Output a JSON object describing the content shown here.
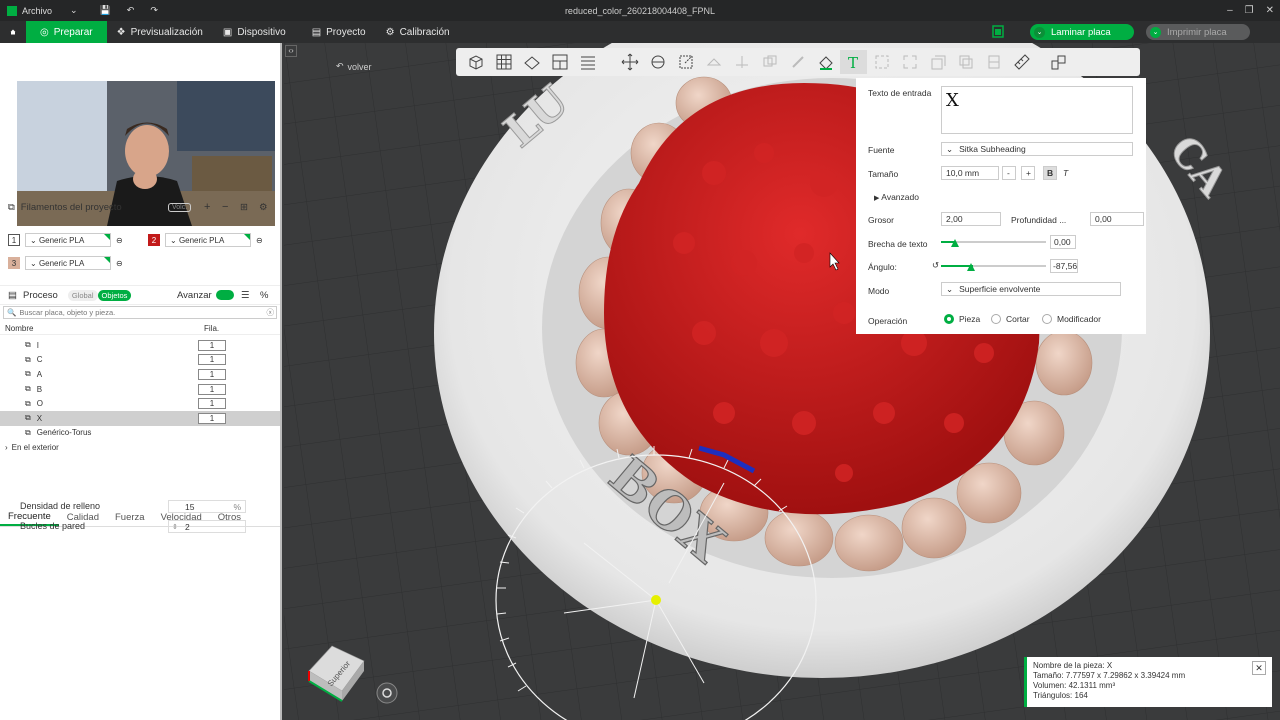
{
  "titlebar": {
    "app_menu": "Archivo",
    "file_title": "reduced_color_260218004408_FPNL"
  },
  "menubar": {
    "tabs": [
      "Preparar",
      "Previsualización",
      "Dispositivo",
      "Proyecto",
      "Calibración"
    ],
    "slice_button": "Laminar placa",
    "print_button": "Imprimir placa"
  },
  "filaments": {
    "title": "Filamentos del proyecto",
    "vol_label": "Volc.",
    "items": [
      {
        "num": "1",
        "name": "Generic PLA",
        "color": "#ffffff"
      },
      {
        "num": "2",
        "name": "Generic PLA",
        "color": "#c21a1a"
      },
      {
        "num": "3",
        "name": "Generic PLA",
        "color": "#d9b09b"
      }
    ]
  },
  "process": {
    "title": "Proceso",
    "global_label": "Global",
    "objects_label": "Objetos",
    "advanced_label": "Avanzar",
    "search_placeholder": "Buscar placa, objeto y pieza.",
    "col_name": "Nombre",
    "col_count": "Fila.",
    "rows": [
      {
        "name": "I",
        "count": "1"
      },
      {
        "name": "C",
        "count": "1"
      },
      {
        "name": "A",
        "count": "1"
      },
      {
        "name": "B",
        "count": "1"
      },
      {
        "name": "O",
        "count": "1"
      },
      {
        "name": "X",
        "count": "1"
      },
      {
        "name": "Genérico-Torus",
        "count": ""
      }
    ],
    "outside_label": "En el exterior"
  },
  "param_tabs": [
    "Frecuente",
    "Calidad",
    "Fuerza",
    "Velocidad",
    "Otros"
  ],
  "params": {
    "fill_density_label": "Densidad de relleno",
    "fill_density_value": "15",
    "fill_density_unit": "%",
    "wall_loops_label": "Bucles de pared",
    "wall_loops_value": "2"
  },
  "viewport": {
    "back_label": "volver",
    "view_cube_label": "Superior",
    "ring_text": "BOX"
  },
  "text_panel": {
    "input_label": "Texto de entrada",
    "input_value": "X",
    "font_label": "Fuente",
    "font_value": "Sitka Subheading",
    "size_label": "Tamaño",
    "size_value": "10,0 mm",
    "advanced_label": "Avanzado",
    "thickness_label": "Grosor",
    "thickness_value": "2,00",
    "depth_label": "Profundidad ...",
    "depth_value": "0,00",
    "gap_label": "Brecha de texto",
    "gap_value": "0,00",
    "angle_label": "Ángulo:",
    "angle_value": "-87,56",
    "mode_label": "Modo",
    "mode_value": "Superficie envolvente",
    "operation_label": "Operación",
    "op_part": "Pieza",
    "op_cut": "Cortar",
    "op_modifier": "Modificador"
  },
  "info_panel": {
    "part_name": "Nombre de la pieza: X",
    "size": "Tamaño: 7.77597 x 7.29862 x 3.39424 mm",
    "volume": "Volumen: 42.1311 mm³",
    "triangles": "Triángulos: 164"
  },
  "colors": {
    "accent": "#00ae42",
    "red_body": "#c21a1a",
    "rim_beads": "#d9b09b"
  }
}
